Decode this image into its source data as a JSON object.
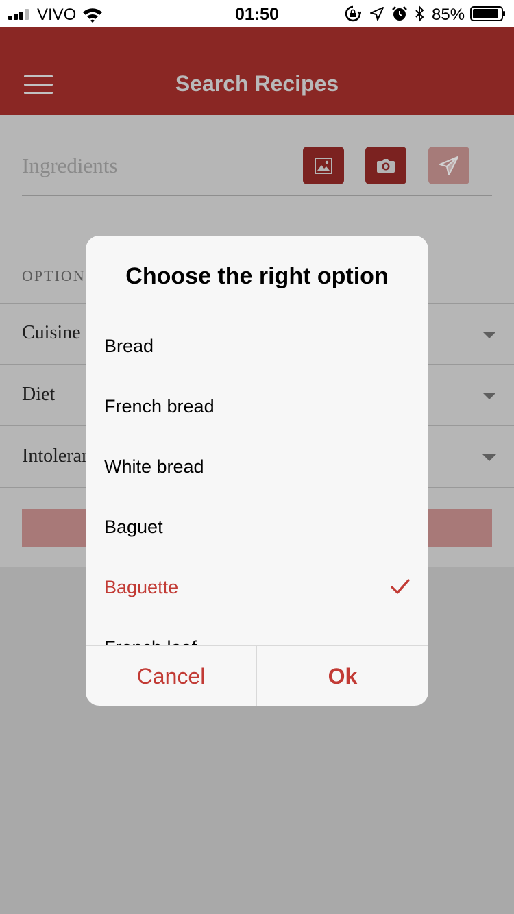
{
  "status_bar": {
    "carrier": "VIVO",
    "time": "01:50",
    "battery": "85%"
  },
  "app_bar": {
    "title": "Search Recipes"
  },
  "form": {
    "ingredients_placeholder": "Ingredients",
    "options_header": "OPTION",
    "options": [
      {
        "label": "Cuisine"
      },
      {
        "label": "Diet"
      },
      {
        "label": "Intoleran"
      }
    ]
  },
  "dialog": {
    "title": "Choose the right option",
    "items": [
      {
        "label": "Bread",
        "selected": false
      },
      {
        "label": "French bread",
        "selected": false
      },
      {
        "label": "White bread",
        "selected": false
      },
      {
        "label": "Baguet",
        "selected": false
      },
      {
        "label": "Baguette",
        "selected": true
      },
      {
        "label": "French loaf",
        "selected": false
      }
    ],
    "cancel_label": "Cancel",
    "ok_label": "Ok"
  },
  "colors": {
    "app_bar": "#8a2724",
    "accent": "#c23b35",
    "overlay_bg": "#b6b6b6"
  }
}
